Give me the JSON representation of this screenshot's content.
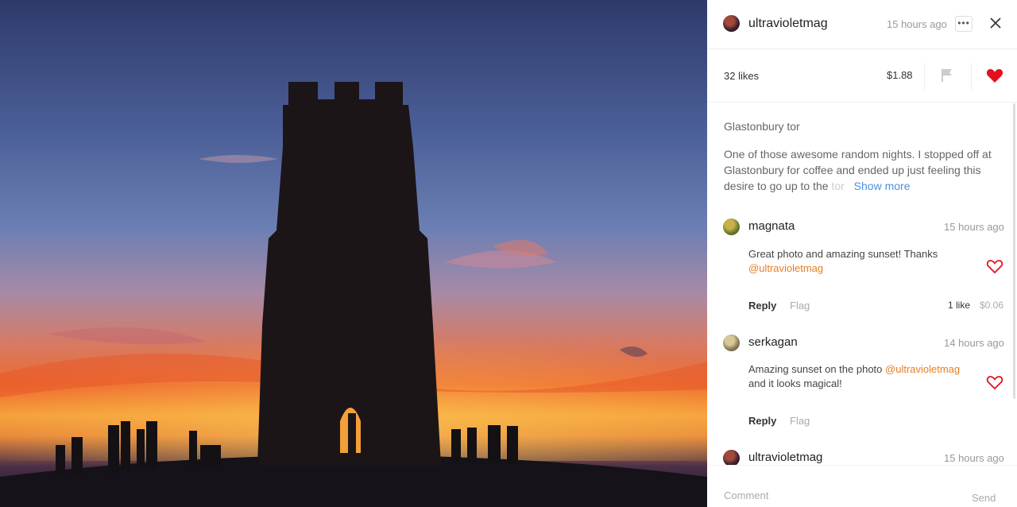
{
  "post": {
    "author": "ultravioletmag",
    "time": "15 hours ago",
    "more_label": "•••",
    "likes": "32 likes",
    "price": "$1.88",
    "title": "Glastonbury tor",
    "description": "One of those awesome random nights. I stopped off at Glastonbury for coffee and ended up just feeling this desire to go up to the",
    "description_fade": "tor",
    "show_more": "Show more",
    "liked": true,
    "heart_color": "#e3101e"
  },
  "comments": [
    {
      "user": "magnata",
      "time": "15 hours ago",
      "text": "Great photo and amazing sunset! Thanks",
      "mention": "@ultravioletmag",
      "text_after": "",
      "reply": "Reply",
      "flag": "Flag",
      "likes": "1 like",
      "price": "$0.06"
    },
    {
      "user": "serkagan",
      "time": "14 hours ago",
      "text": "Amazing sunset on the photo",
      "mention": "@ultravioletmag",
      "text_after": "and it looks magical!",
      "reply": "Reply",
      "flag": "Flag"
    },
    {
      "user": "ultravioletmag",
      "time": "15 hours ago"
    }
  ],
  "composer": {
    "placeholder": "Comment",
    "send": "Send"
  },
  "colors": {
    "accent_link": "#4a90e2",
    "mention": "#e67e22",
    "heart": "#e3101e"
  }
}
